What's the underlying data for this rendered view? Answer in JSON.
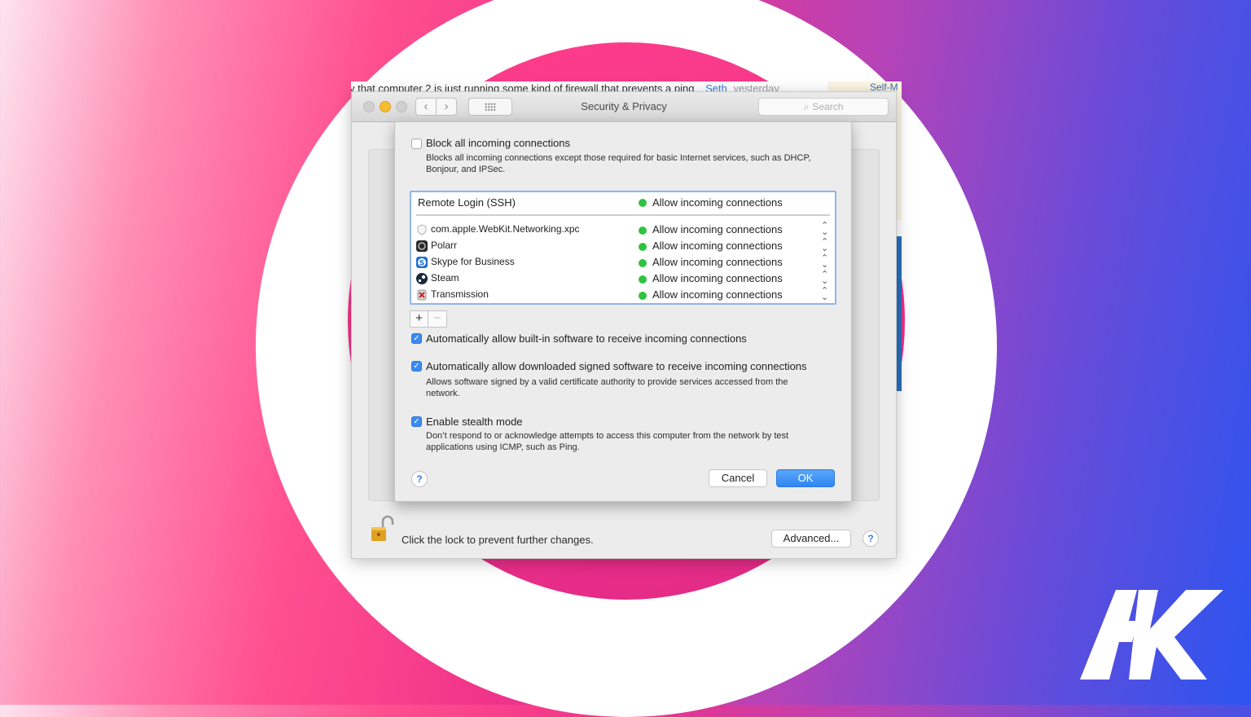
{
  "background_page": {
    "snippet": "y that computer 2 is just running some kind of firewall that prevents a ping",
    "author": "Seth",
    "time": "yesterday",
    "right_link": "Self-M"
  },
  "window": {
    "title": "Security & Privacy",
    "search_placeholder": "Search",
    "lock_text": "Click the lock to prevent further changes.",
    "advanced_label": "Advanced...",
    "help": "?"
  },
  "sheet": {
    "block_all": {
      "label": "Block all incoming connections",
      "description": "Blocks all incoming connections except those required for basic Internet services, such as DHCP, Bonjour, and IPSec.",
      "checked": false
    },
    "list": {
      "header": {
        "name": "Remote Login (SSH)",
        "status": "Allow incoming connections"
      },
      "rows": [
        {
          "name": "com.apple.WebKit.Networking.xpc",
          "status": "Allow incoming connections",
          "icon": "shield-icon"
        },
        {
          "name": "Polarr",
          "status": "Allow incoming connections",
          "icon": "polarr-icon"
        },
        {
          "name": "Skype for Business",
          "status": "Allow incoming connections",
          "icon": "skype-icon"
        },
        {
          "name": "Steam",
          "status": "Allow incoming connections",
          "icon": "steam-icon"
        },
        {
          "name": "Transmission",
          "status": "Allow incoming connections",
          "icon": "transmission-icon"
        }
      ]
    },
    "add_label": "+",
    "remove_label": "−",
    "auto_builtin": {
      "label": "Automatically allow built-in software to receive incoming connections",
      "checked": true
    },
    "auto_signed": {
      "label": "Automatically allow downloaded signed software to receive incoming connections",
      "description": "Allows software signed by a valid certificate authority to provide services accessed from the network.",
      "checked": true
    },
    "stealth": {
      "label": "Enable stealth mode",
      "description": "Don’t respond to or acknowledge attempts to access this computer from the network by test applications using ICMP, such as Ping.",
      "checked": true
    },
    "help": "?",
    "cancel_label": "Cancel",
    "ok_label": "OK"
  },
  "brand": {
    "logo_text": "AK"
  },
  "colors": {
    "accent": "#3b8af0",
    "status_green": "#2ec43f"
  }
}
